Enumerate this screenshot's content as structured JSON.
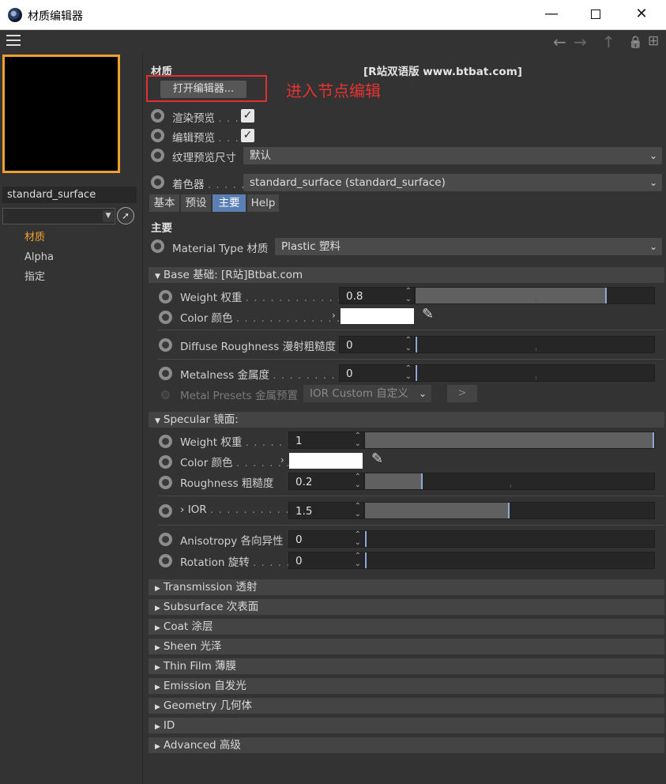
{
  "window": {
    "title": "材质编辑器",
    "min": "—",
    "close": "✕"
  },
  "toolbar": {
    "back_icon": "←",
    "forward_icon": "→",
    "up_icon": "↑",
    "lock_icon": "🔒",
    "new_icon": "⊞"
  },
  "left": {
    "material_name": "standard_surface",
    "nav": [
      "材质",
      "Alpha",
      "指定"
    ]
  },
  "header": {
    "section_label": "材质",
    "watermark": "[R站双语版 www.btbat.com]",
    "open_editor_button": "打开编辑器...",
    "annotation": "进入节点编辑"
  },
  "preview_opts": {
    "render_preview": "渲染预览",
    "edit_preview": "编辑预览",
    "texture_size": "纹理预览尺寸",
    "texture_size_value": "默认",
    "dots1": ". . .",
    "dots2": ". . .",
    "shader_label": "着色器",
    "shader_dots": ". . . . .",
    "shader_value": "standard_surface (standard_surface)"
  },
  "tabs": [
    "基本",
    "预设",
    "主要",
    "Help"
  ],
  "main_section": {
    "title": "主要",
    "material_type_label": "Material Type 材质",
    "material_type_value": "Plastic 塑料"
  },
  "base": {
    "header": "Base 基础:  [R站]Btbat.com",
    "weight_label": "Weight 权重",
    "weight_value": "0.8",
    "weight_fraction": 0.8,
    "color_label": "Color 颜色",
    "diffuse_label": "Diffuse Roughness 漫射粗糙度",
    "diffuse_value": "0",
    "metalness_label": "Metalness 金属度",
    "metalness_value": "0",
    "presets_label": "Metal Presets 金属预置",
    "presets_value": "IOR Custom 自定义",
    "presets_button": ">"
  },
  "specular": {
    "header": "Specular 镜面:",
    "weight_label": "Weight 权重",
    "weight_value": "1",
    "weight_fraction": 1.0,
    "color_label": "Color 颜色",
    "roughness_label": "Roughness 粗糙度",
    "roughness_value": "0.2",
    "roughness_fraction": 0.2,
    "ior_label": "IOR",
    "ior_value": "1.5",
    "ior_fraction": 0.5,
    "anisotropy_label": "Anisotropy 各向异性",
    "anisotropy_value": "0",
    "rotation_label": "Rotation 旋转",
    "rotation_value": "0"
  },
  "collapsed_sections": [
    "Transmission 透射",
    "Subsurface 次表面",
    "Coat 涂层",
    "Sheen 光泽",
    "Thin Film 薄膜",
    "Emission 自发光",
    "Geometry 几何体",
    "ID",
    "Advanced 高级"
  ],
  "colors": {
    "accent": "#f0a030",
    "tab_active": "#5a7fb5",
    "annotation": "#e53333",
    "slider_mark": "#8fa8d8"
  }
}
